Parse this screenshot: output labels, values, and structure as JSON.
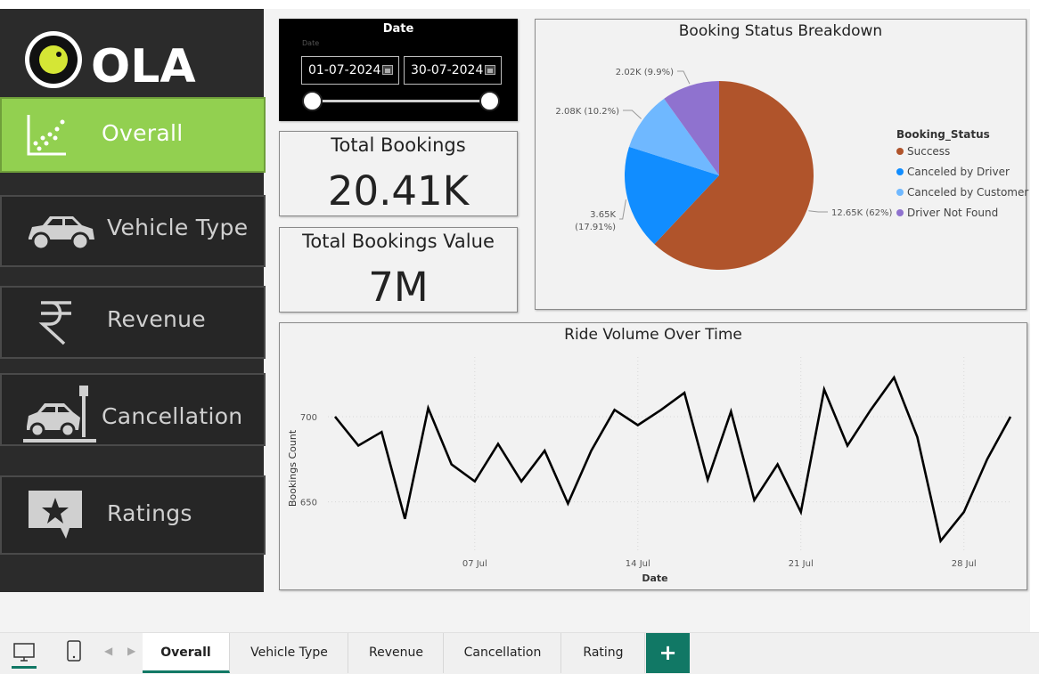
{
  "brand": {
    "name": "OLA"
  },
  "sidebar": {
    "items": [
      {
        "label": "Overall",
        "icon": "scatter-chart-icon"
      },
      {
        "label": "Vehicle Type",
        "icon": "car-icon"
      },
      {
        "label": "Revenue",
        "icon": "rupee-icon"
      },
      {
        "label": "Cancellation",
        "icon": "car-crash-icon"
      },
      {
        "label": "Ratings",
        "icon": "star-message-icon"
      }
    ]
  },
  "date_filter": {
    "title": "Date",
    "caption": "Date",
    "start": "01-07-2024",
    "end": "30-07-2024"
  },
  "kpis": {
    "total_bookings": {
      "title": "Total Bookings",
      "value": "20.41K"
    },
    "total_value": {
      "title": "Total Bookings Value",
      "value": "7M"
    }
  },
  "pie": {
    "title": "Booking Status Breakdown",
    "legend_title": "Booking_Status",
    "slices": [
      {
        "name": "Success",
        "value": 12.65,
        "label": "12.65K (62%)",
        "color": "#b0542b"
      },
      {
        "name": "Canceled by Driver",
        "value": 3.65,
        "label_line1": "3.65K",
        "label_line2": "(17.91%)",
        "color": "#118dff"
      },
      {
        "name": "Canceled by Customer",
        "value": 2.08,
        "label": "2.08K (10.2%)",
        "color": "#6fb8ff"
      },
      {
        "name": "Driver Not Found",
        "value": 2.02,
        "label": "2.02K (9.9%)",
        "color": "#8f72cf"
      }
    ]
  },
  "chart_data": {
    "type": "line",
    "title": "Ride Volume Over Time",
    "xlabel": "Date",
    "ylabel": "Bookings Count",
    "x": [
      "01 Jul",
      "02 Jul",
      "03 Jul",
      "04 Jul",
      "05 Jul",
      "06 Jul",
      "07 Jul",
      "08 Jul",
      "09 Jul",
      "10 Jul",
      "11 Jul",
      "12 Jul",
      "13 Jul",
      "14 Jul",
      "15 Jul",
      "16 Jul",
      "17 Jul",
      "18 Jul",
      "19 Jul",
      "20 Jul",
      "21 Jul",
      "22 Jul",
      "23 Jul",
      "24 Jul",
      "25 Jul",
      "26 Jul",
      "27 Jul",
      "28 Jul",
      "29 Jul",
      "30 Jul"
    ],
    "values": [
      700,
      683,
      691,
      640,
      705,
      672,
      662,
      684,
      662,
      680,
      649,
      680,
      704,
      695,
      704,
      714,
      663,
      703,
      651,
      672,
      644,
      716,
      683,
      704,
      723,
      688,
      627,
      644,
      675,
      700
    ],
    "x_ticks": [
      "07 Jul",
      "14 Jul",
      "21 Jul",
      "28 Jul"
    ],
    "x_tick_positions": [
      6,
      13,
      20,
      27
    ],
    "y_ticks": [
      650,
      700
    ],
    "ylim": [
      620,
      735
    ],
    "grid": true,
    "color": "#000000"
  },
  "tabs": {
    "items": [
      "Overall",
      "Vehicle Type",
      "Revenue",
      "Cancellation",
      "Rating"
    ],
    "active": "Overall",
    "add_label": "+"
  }
}
